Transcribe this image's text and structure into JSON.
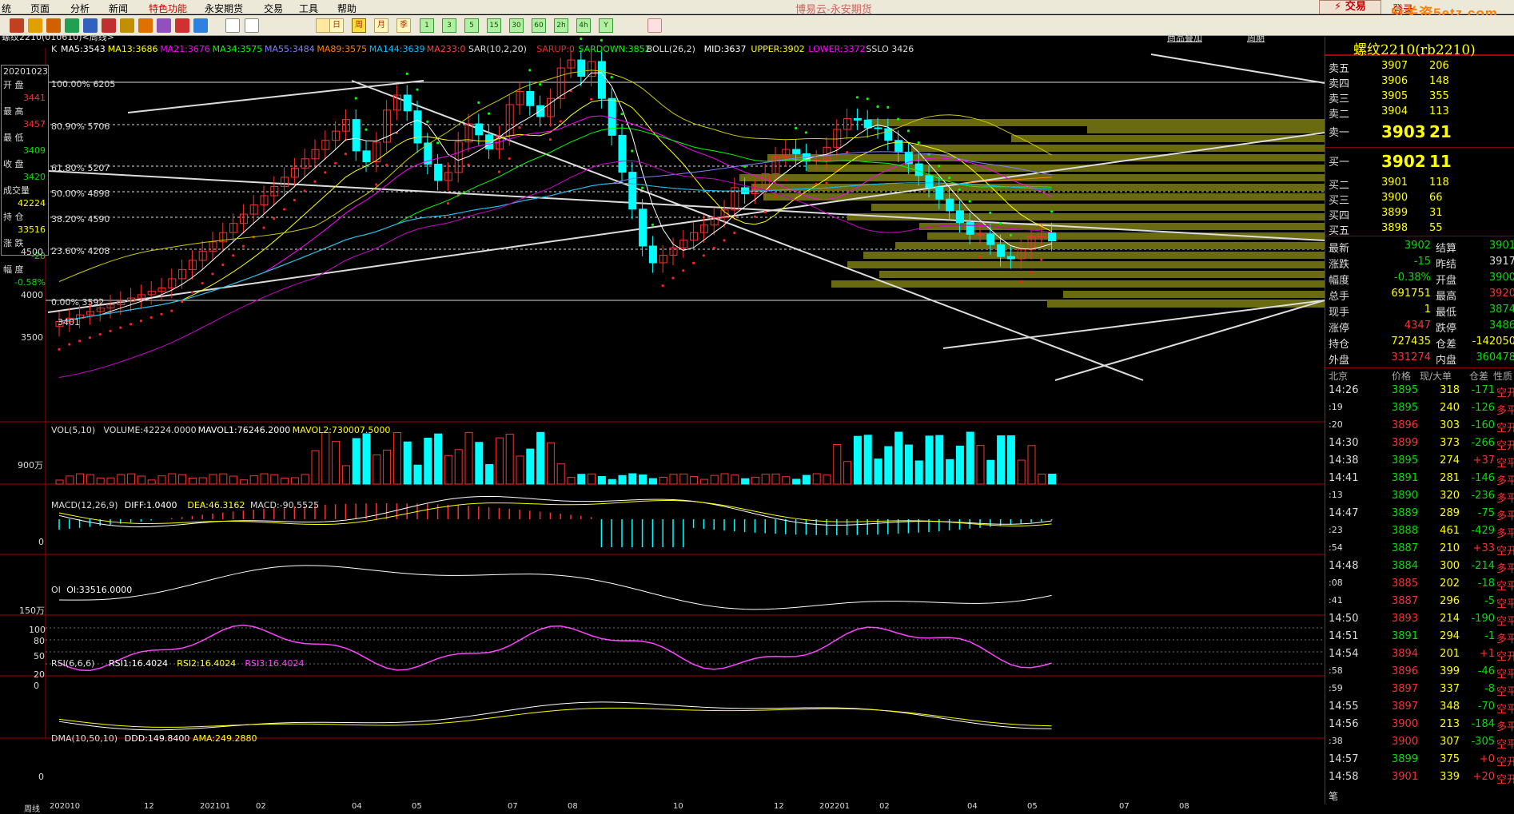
{
  "menu": {
    "items": [
      "统",
      "页面",
      "分析",
      "新闻",
      "特色功能",
      "永安期货",
      "交易",
      "工具",
      "帮助"
    ],
    "title": "博易云-永安期货",
    "trade_btn": "⚡ 交易",
    "login": "登录",
    "watermark": "5t关资5etz.com"
  },
  "toolbar": {
    "periods": [
      "日",
      "周",
      "月",
      "季"
    ],
    "minutes": [
      "1",
      "3",
      "5",
      "15",
      "30",
      "60",
      "2h",
      "4h",
      "Y"
    ]
  },
  "chart": {
    "symbol_line": "螺纹2210(010610)<周线>",
    "tab_goods": "商品叠加",
    "tab_period": "周期",
    "ma": [
      {
        "label": "MA5:3543",
        "color": "#ffffff"
      },
      {
        "label": "MA13:3686",
        "color": "#ffff00"
      },
      {
        "label": "MA21:3676",
        "color": "#ff00ff"
      },
      {
        "label": "MA34:3575",
        "color": "#00ff00"
      },
      {
        "label": "MA55:3484",
        "color": "#8080ff"
      },
      {
        "label": "MA89:3575",
        "color": "#ff8000"
      },
      {
        "label": "MA144:3639",
        "color": "#00c0ff"
      },
      {
        "label": "MA233:0",
        "color": "#ff4040"
      }
    ],
    "sar": [
      {
        "label": "SAR(10,2,20)",
        "color": "#dddddd"
      },
      {
        "label": "SARUP:0",
        "color": "#ff2020"
      },
      {
        "label": "SARDOWN:3852",
        "color": "#00ff00"
      }
    ],
    "boll": [
      {
        "label": "BOLL(26,2)",
        "color": "#dddddd"
      },
      {
        "label": "MID:3637",
        "color": "#ffffff"
      },
      {
        "label": "UPPER:3902",
        "color": "#ffff00"
      },
      {
        "label": "LOWER:3372",
        "color": "#ff00ff"
      },
      {
        "label": "SSLO 3426",
        "color": "#dddddd"
      }
    ],
    "fib": [
      "100.00% 6205",
      "80.90% 5706",
      "61.80% 5207",
      "50.00% 4898",
      "38.20% 4590",
      "23.60% 4208",
      "0.00% 3592"
    ],
    "price_axis": [
      "4500",
      "4000",
      "3500"
    ],
    "low_mark": "3401"
  },
  "info": {
    "date": "20201023",
    "rows": [
      {
        "k": "开 盘",
        "v": "3441",
        "c": "red"
      },
      {
        "k": "最 高",
        "v": "3457",
        "c": "red"
      },
      {
        "k": "最 低",
        "v": "3409",
        "c": "grn"
      },
      {
        "k": "收 盘",
        "v": "3420",
        "c": "grn"
      },
      {
        "k": "成交量",
        "v": "42224",
        "c": "yel"
      },
      {
        "k": "持 仓",
        "v": "33516",
        "c": "yel"
      },
      {
        "k": "涨 跌",
        "v": "-20",
        "c": "grn"
      },
      {
        "k": "幅 度",
        "v": "-0.58%",
        "c": "grn"
      }
    ]
  },
  "vol": {
    "header": "VOL(5,10)",
    "items": [
      {
        "label": "VOLUME:42224.0000",
        "color": "#dddddd"
      },
      {
        "label": "MAVOL1:76246.2000",
        "color": "#ffffff"
      },
      {
        "label": "MAVOL2:730007.5000",
        "color": "#ffff00"
      }
    ],
    "axis": "900万"
  },
  "macd": {
    "header": "MACD(12,26,9)",
    "items": [
      {
        "label": "DIFF:1.0400",
        "color": "#ffffff"
      },
      {
        "label": "DEA:46.3162",
        "color": "#ffff00"
      },
      {
        "label": "MACD:-90.5525",
        "color": "#dddddd"
      }
    ],
    "axis": "0"
  },
  "oi": {
    "header": "OI",
    "items": [
      {
        "label": "OI:33516.0000",
        "color": "#ffffff"
      }
    ],
    "axis": "150万"
  },
  "rsi": {
    "header": "RSI(6,6,6)",
    "items": [
      {
        "label": "RSI1:16.4024",
        "color": "#ffffff"
      },
      {
        "label": "RSI2:16.4024",
        "color": "#ffff00"
      },
      {
        "label": "RSI3:16.4024",
        "color": "#ff40ff"
      }
    ],
    "axis": [
      "100",
      "80",
      "50",
      "20",
      "0"
    ]
  },
  "dma": {
    "header": "DMA(10,50,10)",
    "items": [
      {
        "label": "DDD:149.8400",
        "color": "#ffffff"
      },
      {
        "label": "AMA:249.2880",
        "color": "#ffff00"
      }
    ],
    "axis": "0"
  },
  "time_axis": [
    "周线",
    "202010",
    "12",
    "202101",
    "02",
    "04",
    "05",
    "07",
    "08",
    "10",
    "12",
    "202201",
    "02",
    "04",
    "05",
    "07",
    "08"
  ],
  "right": {
    "title": "螺纹2210(rb2210)",
    "asks": [
      {
        "l": "卖五",
        "p": "3907",
        "v": "206"
      },
      {
        "l": "卖四",
        "p": "3906",
        "v": "148"
      },
      {
        "l": "卖三",
        "p": "3905",
        "v": "355"
      },
      {
        "l": "卖二",
        "p": "3904",
        "v": "113"
      }
    ],
    "ask1": {
      "l": "卖一",
      "p": "3903",
      "v": "21"
    },
    "bid1": {
      "l": "买一",
      "p": "3902",
      "v": "11"
    },
    "bids": [
      {
        "l": "买二",
        "p": "3901",
        "v": "118"
      },
      {
        "l": "买三",
        "p": "3900",
        "v": "66"
      },
      {
        "l": "买四",
        "p": "3899",
        "v": "31"
      },
      {
        "l": "买五",
        "p": "3898",
        "v": "55"
      }
    ],
    "stats": [
      {
        "a": "最新",
        "b": "3902",
        "bc": "grn",
        "c": "结算",
        "d": "3901",
        "dc": "grn"
      },
      {
        "a": "涨跌",
        "b": "-15",
        "bc": "grn",
        "c": "昨结",
        "d": "3917",
        "dc": "wht"
      },
      {
        "a": "幅度",
        "b": "-0.38%",
        "bc": "grn",
        "c": "开盘",
        "d": "3900",
        "dc": "grn"
      },
      {
        "a": "总手",
        "b": "691751",
        "bc": "yel",
        "c": "最高",
        "d": "3920",
        "dc": "red"
      },
      {
        "a": "现手",
        "b": "1",
        "bc": "yel",
        "c": "最低",
        "d": "3874",
        "dc": "grn"
      },
      {
        "a": "涨停",
        "b": "4347",
        "bc": "red",
        "c": "跌停",
        "d": "3486",
        "dc": "grn"
      },
      {
        "a": "持仓",
        "b": "727435",
        "bc": "yel",
        "c": "仓差",
        "d": "-142050",
        "dc": "yel"
      },
      {
        "a": "外盘",
        "b": "331274",
        "bc": "red",
        "c": "内盘",
        "d": "360478",
        "dc": "grn"
      }
    ],
    "tick_header": [
      "北京",
      "价格",
      "现/大单",
      "仓差",
      "性质"
    ],
    "ticks": [
      {
        "t": "14:26",
        "p": "3895",
        "pc": "grn",
        "v": "318",
        "vc": "red",
        "o": "-171",
        "n": "空开"
      },
      {
        "t": ":19",
        "p": "3895",
        "pc": "grn",
        "v": "240",
        "vc": "yel",
        "o": "-126",
        "n": "多平"
      },
      {
        "t": ":20",
        "p": "3896",
        "pc": "red",
        "v": "303",
        "vc": "red",
        "o": "-160",
        "n": "空开"
      },
      {
        "t": "14:30",
        "p": "3899",
        "pc": "red",
        "v": "373",
        "vc": "red",
        "o": "-266",
        "n": "空开"
      },
      {
        "t": "14:38",
        "p": "3895",
        "pc": "grn",
        "v": "274",
        "vc": "yel",
        "o": "+37",
        "n": "空平"
      },
      {
        "t": "14:41",
        "p": "3891",
        "pc": "grn",
        "v": "281",
        "vc": "red",
        "o": "-146",
        "n": "多平"
      },
      {
        "t": ":13",
        "p": "3890",
        "pc": "grn",
        "v": "320",
        "vc": "yel",
        "o": "-236",
        "n": "多平"
      },
      {
        "t": "14:47",
        "p": "3889",
        "pc": "grn",
        "v": "289",
        "vc": "yel",
        "o": "-75",
        "n": "多平"
      },
      {
        "t": ":23",
        "p": "3888",
        "pc": "grn",
        "v": "461",
        "vc": "yel",
        "o": "-429",
        "n": "多平"
      },
      {
        "t": ":54",
        "p": "3887",
        "pc": "grn",
        "v": "210",
        "vc": "yel",
        "o": "+33",
        "n": "空开"
      },
      {
        "t": "14:48",
        "p": "3884",
        "pc": "grn",
        "v": "300",
        "vc": "yel",
        "o": "-214",
        "n": "多平"
      },
      {
        "t": ":08",
        "p": "3885",
        "pc": "red",
        "v": "202",
        "vc": "red",
        "o": "-18",
        "n": "空平"
      },
      {
        "t": ":41",
        "p": "3887",
        "pc": "red",
        "v": "296",
        "vc": "red",
        "o": "-5",
        "n": "空平"
      },
      {
        "t": "14:50",
        "p": "3893",
        "pc": "red",
        "v": "214",
        "vc": "red",
        "o": "-190",
        "n": "空平"
      },
      {
        "t": "14:51",
        "p": "3891",
        "pc": "grn",
        "v": "294",
        "vc": "yel",
        "o": "-1",
        "n": "多平"
      },
      {
        "t": "14:54",
        "p": "3894",
        "pc": "red",
        "v": "201",
        "vc": "red",
        "o": "+1",
        "n": "空开"
      },
      {
        "t": ":58",
        "p": "3896",
        "pc": "red",
        "v": "399",
        "vc": "red",
        "o": "-46",
        "n": "空平"
      },
      {
        "t": ":59",
        "p": "3897",
        "pc": "red",
        "v": "337",
        "vc": "red",
        "o": "-8",
        "n": "空平"
      },
      {
        "t": "14:55",
        "p": "3897",
        "pc": "red",
        "v": "348",
        "vc": "red",
        "o": "-70",
        "n": "空平"
      },
      {
        "t": "14:56",
        "p": "3900",
        "pc": "red",
        "v": "213",
        "vc": "red",
        "o": "-184",
        "n": "多平"
      },
      {
        "t": ":38",
        "p": "3900",
        "pc": "red",
        "v": "307",
        "vc": "red",
        "o": "-305",
        "n": "空平"
      },
      {
        "t": "14:57",
        "p": "3899",
        "pc": "grn",
        "v": "375",
        "vc": "yel",
        "o": "+0",
        "n": "空开"
      },
      {
        "t": "14:58",
        "p": "3901",
        "pc": "red",
        "v": "339",
        "vc": "red",
        "o": "+20",
        "n": "空开"
      }
    ],
    "footer": "笔"
  }
}
